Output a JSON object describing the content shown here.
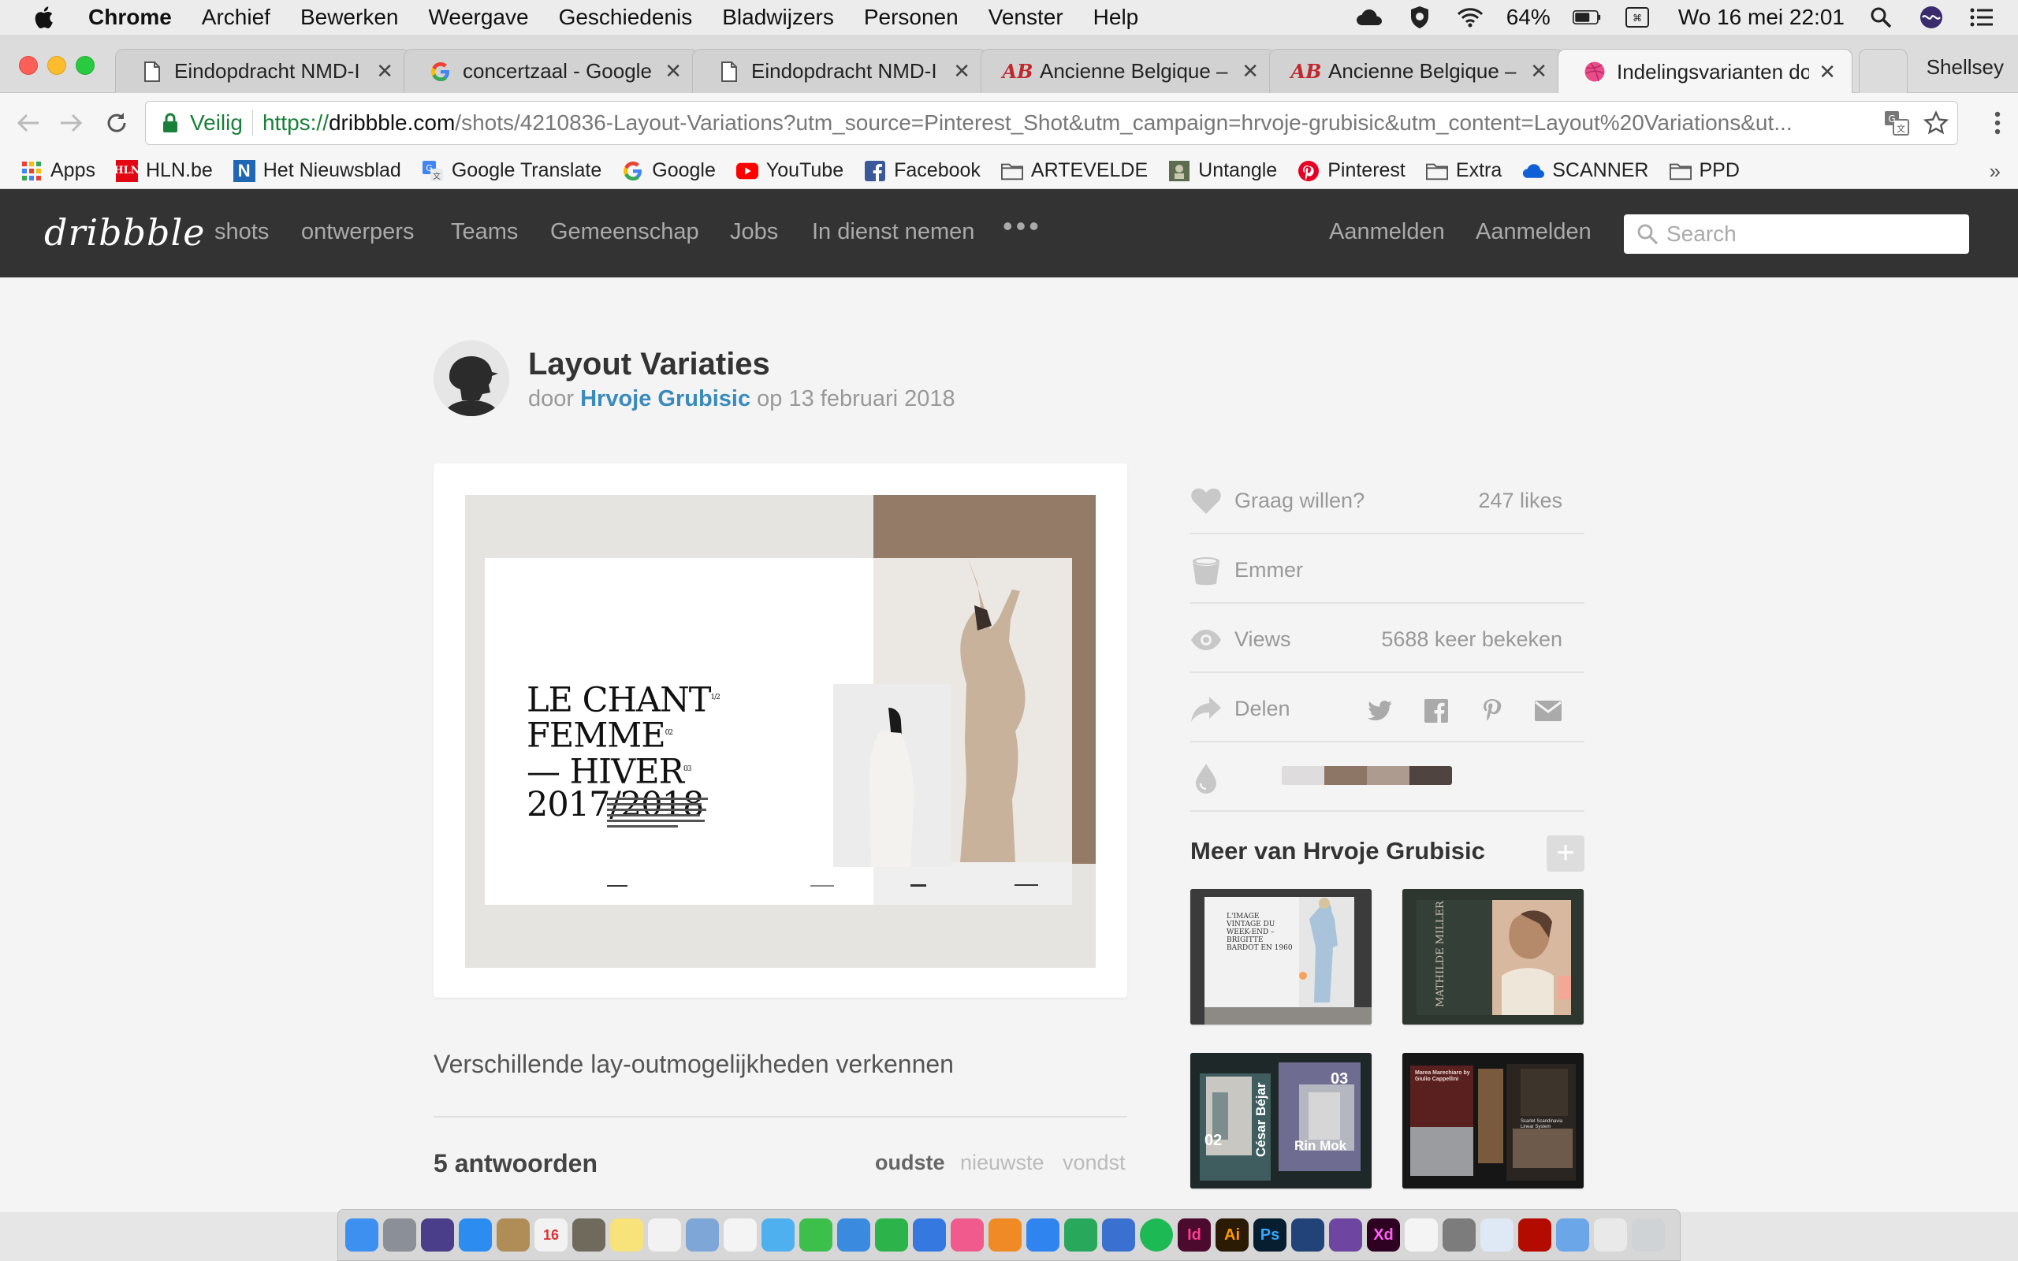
{
  "menubar": {
    "app_name": "Chrome",
    "items": [
      "Archief",
      "Bewerken",
      "Weergave",
      "Geschiedenis",
      "Bladwijzers",
      "Personen",
      "Venster",
      "Help"
    ],
    "battery": "64%",
    "clock": "Wo 16 mei  22:01"
  },
  "tabs": [
    {
      "title": "Eindopdracht NMD-I",
      "icon": "document-icon"
    },
    {
      "title": "concertzaal - Google z",
      "icon": "google-icon"
    },
    {
      "title": "Eindopdracht NMD-I",
      "icon": "document-icon"
    },
    {
      "title": "Ancienne Belgique – O",
      "icon": "ab-icon"
    },
    {
      "title": "Ancienne Belgique – O",
      "icon": "ab-icon"
    },
    {
      "title": "Indelingsvarianten doo",
      "icon": "dribbble-icon"
    }
  ],
  "profile_name": "Shellsey",
  "omnibox": {
    "secure_label": "Veilig",
    "scheme": "https://",
    "host": "dribbble.com",
    "path": "/shots/4210836-Layout-Variations?utm_source=Pinterest_Shot&utm_campaign=hrvoje-grubisic&utm_content=Layout%20Variations&ut..."
  },
  "bookmarks": [
    {
      "label": "Apps",
      "icon": "apps-grid-icon"
    },
    {
      "label": "HLN.be",
      "icon": "hln-icon"
    },
    {
      "label": "Het Nieuwsblad",
      "icon": "nieuwsblad-icon"
    },
    {
      "label": "Google Translate",
      "icon": "translate-icon"
    },
    {
      "label": "Google",
      "icon": "google-icon"
    },
    {
      "label": "YouTube",
      "icon": "youtube-icon"
    },
    {
      "label": "Facebook",
      "icon": "facebook-icon"
    },
    {
      "label": "ARTEVELDE",
      "icon": "folder-icon"
    },
    {
      "label": "Untangle",
      "icon": "untangle-icon"
    },
    {
      "label": "Pinterest",
      "icon": "pinterest-icon"
    },
    {
      "label": "Extra",
      "icon": "folder-icon"
    },
    {
      "label": "SCANNER",
      "icon": "cloud-icon"
    },
    {
      "label": "PPD",
      "icon": "folder-icon"
    }
  ],
  "site": {
    "logo": "dribbble",
    "nav": [
      "shots",
      "ontwerpers",
      "Teams",
      "Gemeenschap",
      "Jobs",
      "In dienst nemen"
    ],
    "more": "•••",
    "sign_in": "Aanmelden",
    "sign_up": "Aanmelden",
    "search_placeholder": "Search"
  },
  "shot": {
    "title": "Layout Variaties",
    "by": "door",
    "author": "Hrvoje Grubisic",
    "on": "op",
    "date": "13 februari 2018",
    "description": "Verschillende lay-outmogelijkheden verkennen",
    "image_text": {
      "lines": [
        "LE CHANT",
        "FEMME",
        "— HIVER",
        "2017/2018"
      ],
      "superscripts": [
        "1/2",
        "02",
        "03"
      ]
    }
  },
  "sidebar": {
    "like_label": "Graag willen?",
    "likes": "247 likes",
    "bucket_label": "Emmer",
    "views_label": "Views",
    "views": "5688 keer bekeken",
    "share_label": "Delen",
    "share_icons": [
      "twitter-icon",
      "facebook-icon",
      "pinterest-icon",
      "email-icon"
    ],
    "palette": [
      "#dedcdc",
      "#8d7665",
      "#ac9b8e",
      "#4f4440"
    ],
    "more_title": "Meer van Hrvoje Grubisic",
    "add_label": "+"
  },
  "thumbs": [
    {
      "text": "L'IMAGE VINTAGE DU WEEK-END – BRIGITTE BARDOT EN 1960",
      "bg": "#3a3a3a"
    },
    {
      "text": "MATHILDE MILLER",
      "bg": "#2f3a33"
    },
    {
      "text": "César Béjar",
      "num1": "02",
      "num2": "03",
      "label": "Rin Mok",
      "bg": "#1e2a2a"
    },
    {
      "text": "Marea Marechiaro by Giulio Cappellini",
      "sub": "Scarlet Scandinavia Linear System",
      "bg": "#151515"
    }
  ],
  "responses": {
    "count_label": "5 antwoorden",
    "sort": [
      "oudste",
      "nieuwste",
      "vondst"
    ]
  },
  "colors": {
    "header_bg": "#333333",
    "author_link": "#3a8bbb",
    "secure_green": "#188038"
  }
}
